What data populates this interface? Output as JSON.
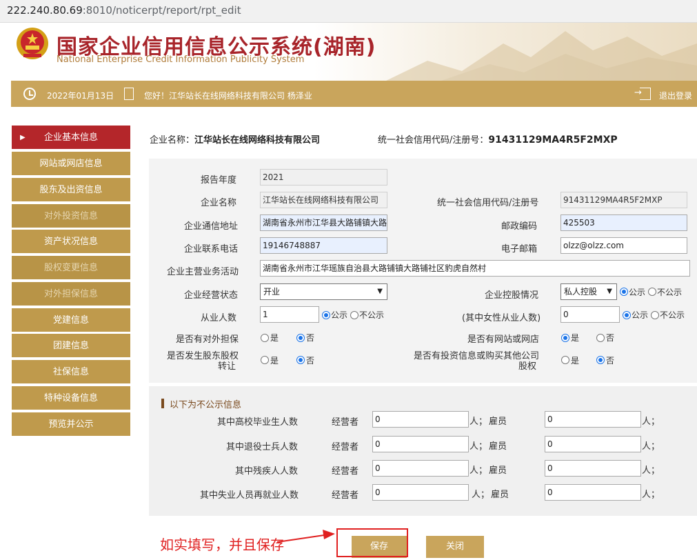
{
  "browser": {
    "url_host": "222.240.80.69",
    "url_path": ":8010/noticerpt/report/rpt_edit"
  },
  "header": {
    "title_cn": "国家企业信用信息公示系统(湖南)",
    "title_en": "National Enterprise Credit Information Publicity System"
  },
  "status": {
    "date": "2022年01月13日",
    "greeting": "您好！江华站长在线网络科技有限公司  杨泽业",
    "logout": "退出登录"
  },
  "sidebar": {
    "items": [
      {
        "label": "企业基本信息"
      },
      {
        "label": "网站或网店信息"
      },
      {
        "label": "股东及出资信息"
      },
      {
        "label": "对外投资信息"
      },
      {
        "label": "资产状况信息"
      },
      {
        "label": "股权变更信息"
      },
      {
        "label": "对外担保信息"
      },
      {
        "label": "党建信息"
      },
      {
        "label": "团建信息"
      },
      {
        "label": "社保信息"
      },
      {
        "label": "特种设备信息"
      },
      {
        "label": "预览并公示"
      }
    ]
  },
  "company": {
    "name_label": "企业名称：",
    "name": "江华站长在线网络科技有限公司",
    "code_label": "统一社会信用代码/注册号：",
    "code": "91431129MA4R5F2MXP"
  },
  "form": {
    "year_label": "报告年度",
    "year": "2021",
    "name_label": "企业名称",
    "name": "江华站长在线网络科技有限公司",
    "credit_label": "统一社会信用代码/注册号",
    "credit": "91431129MA4R5F2MXP",
    "address_label": "企业通信地址",
    "address": "湖南省永州市江华县大路铺镇大路",
    "postcode_label": "邮政编码",
    "postcode": "425503",
    "phone_label": "企业联系电话",
    "phone": "19146748887",
    "email_label": "电子邮箱",
    "email": "olzz@olzz.com",
    "business_label": "企业主营业务活动",
    "business": "湖南省永州市江华瑶族自治县大路铺镇大路铺社区豹虎自然村",
    "status_label": "企业经营状态",
    "status": "开业",
    "control_label": "企业控股情况",
    "control": "私人控股",
    "public": "公示",
    "not_public": "不公示",
    "employees_label": "从业人数",
    "employees": "1",
    "female_label": "(其中女性从业人数)",
    "female": "0",
    "guarantee_label": "是否有对外担保",
    "website_label": "是否有网站或网店",
    "transfer_label_1": "是否发生股东股权",
    "transfer_label_2": "转让",
    "invest_label_1": "是否有投资信息或购买其他公司",
    "invest_label_2": "股权",
    "yes": "是",
    "no": "否"
  },
  "hidden": {
    "title": "以下为不公示信息",
    "operator": "经营者",
    "employee": "雇员",
    "unit": "人；",
    "rows": [
      {
        "label": "其中高校毕业生人数",
        "op": "0",
        "emp": "0"
      },
      {
        "label": "其中退役士兵人数",
        "op": "0",
        "emp": "0"
      },
      {
        "label": "其中残疾人人数",
        "op": "0",
        "emp": "0"
      },
      {
        "label": "其中失业人员再就业人数",
        "op": "0",
        "emp": "0"
      }
    ]
  },
  "buttons": {
    "save": "保存",
    "close": "关闭"
  },
  "annotation": {
    "text": "如实填写，并且保存"
  },
  "colors": {
    "brand_red": "#b4262a",
    "gold": "#c9a55c",
    "annot_red": "#e02020"
  }
}
